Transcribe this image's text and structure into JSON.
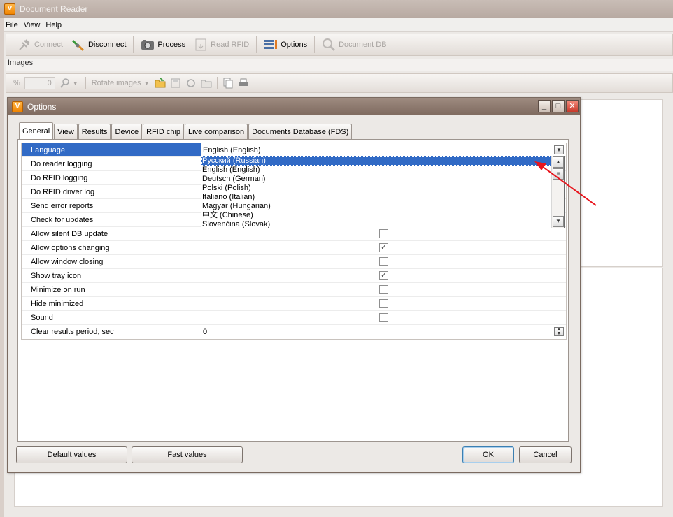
{
  "window": {
    "title": "Document Reader"
  },
  "menu": [
    "File",
    "View",
    "Help"
  ],
  "toolbar": {
    "connect": "Connect",
    "disconnect": "Disconnect",
    "process": "Process",
    "read_rfid": "Read RFID",
    "options": "Options",
    "document_db": "Document DB"
  },
  "images_bar": {
    "label": "Images",
    "zoom_unit": "%",
    "zoom_value": "0",
    "rotate": "Rotate images"
  },
  "dialog": {
    "title": "Options",
    "tabs": [
      "General",
      "View",
      "Results",
      "Device",
      "RFID chip",
      "Live comparison",
      "Documents Database (FDS)"
    ],
    "rows": [
      {
        "name": "Language",
        "value": "English (English)"
      },
      {
        "name": "Do reader logging"
      },
      {
        "name": "Do RFID logging"
      },
      {
        "name": "Do RFID driver log"
      },
      {
        "name": "Send error reports"
      },
      {
        "name": "Check for updates"
      },
      {
        "name": "Allow silent DB update",
        "checked": false
      },
      {
        "name": "Allow options changing",
        "checked": true
      },
      {
        "name": "Allow window closing",
        "checked": false
      },
      {
        "name": "Show tray icon",
        "checked": true
      },
      {
        "name": "Minimize on run",
        "checked": false
      },
      {
        "name": "Hide minimized",
        "checked": false
      },
      {
        "name": "Sound",
        "checked": false
      },
      {
        "name": "Clear results period, sec",
        "value": "0"
      }
    ],
    "languages": [
      "Русский (Russian)",
      "English (English)",
      "Deutsch (German)",
      "Polski (Polish)",
      "Italiano (Italian)",
      "Magyar (Hungarian)",
      "中文 (Chinese)",
      "Slovenčina (Slovak)"
    ],
    "buttons": {
      "default_values": "Default values",
      "fast_values": "Fast values",
      "ok": "OK",
      "cancel": "Cancel"
    }
  },
  "colors": {
    "selection": "#316ac5",
    "annotation_arrow": "#e8141c"
  }
}
